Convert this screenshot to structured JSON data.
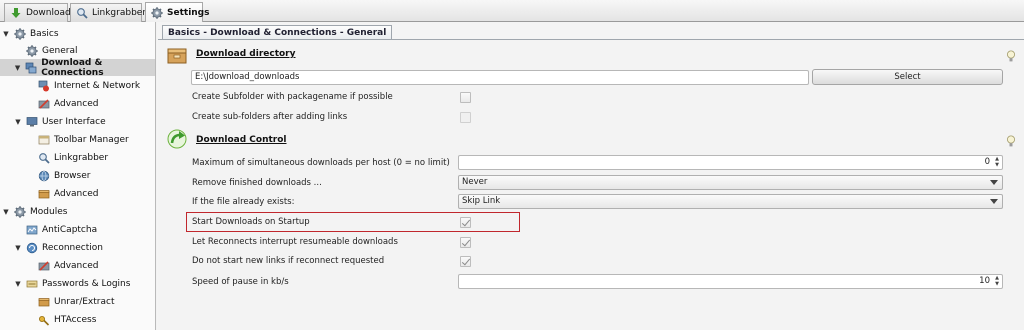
{
  "tabs": [
    {
      "label": "Download",
      "icon": "download-arrow-icon"
    },
    {
      "label": "Linkgrabber",
      "icon": "linkgrabber-icon"
    },
    {
      "label": "Settings",
      "icon": "gear-icon"
    }
  ],
  "sidebar": {
    "items": [
      {
        "label": "Basics",
        "icon": "gear-icon"
      },
      {
        "label": "General",
        "icon": "gear-icon"
      },
      {
        "label": "Download & Connections",
        "icon": "network-icon"
      },
      {
        "label": "Internet & Network",
        "icon": "network-warning-icon"
      },
      {
        "label": "Advanced",
        "icon": "advanced-tools-icon"
      },
      {
        "label": "User Interface",
        "icon": "monitor-icon"
      },
      {
        "label": "Toolbar Manager",
        "icon": "toolbar-icon"
      },
      {
        "label": "Linkgrabber",
        "icon": "linkgrabber-icon"
      },
      {
        "label": "Browser",
        "icon": "browser-icon"
      },
      {
        "label": "Advanced",
        "icon": "advanced-box-icon"
      },
      {
        "label": "Modules",
        "icon": "gear-icon"
      },
      {
        "label": "AntiCaptcha",
        "icon": "captcha-icon"
      },
      {
        "label": "Reconnection",
        "icon": "reconnect-icon"
      },
      {
        "label": "Advanced",
        "icon": "advanced-tools-icon"
      },
      {
        "label": "Passwords & Logins",
        "icon": "password-icon"
      },
      {
        "label": "Unrar/Extract",
        "icon": "archive-box-icon"
      },
      {
        "label": "HTAccess",
        "icon": "key-icon"
      }
    ]
  },
  "panel_tab": "Basics - Download & Connections - General",
  "download_directory": {
    "title": "Download directory",
    "path_value": "E:\\Jdownload_downloads",
    "select_label": "Select",
    "create_subfolder_label": "Create Subfolder with packagename if possible",
    "create_subfolder_checked": false,
    "create_subfolders_after_adding_label": "Create sub-folders after adding links",
    "create_subfolders_after_adding_checked": false
  },
  "download_control": {
    "title": "Download Control",
    "max_downloads_label": "Maximum of simultaneous downloads per host (0 = no limit)",
    "max_downloads_value": "0",
    "remove_finished_label": "Remove finished downloads ...",
    "remove_finished_value": "Never",
    "file_exists_label": "If the file already exists:",
    "file_exists_value": "Skip Link",
    "start_on_startup_label": "Start Downloads on Startup",
    "start_on_startup_checked": true,
    "reconnects_interrupt_label": "Let Reconnects interrupt resumeable downloads",
    "reconnects_interrupt_checked": true,
    "no_new_links_label": "Do not start new links if reconnect requested",
    "no_new_links_checked": true,
    "pause_speed_label": "Speed of pause in kb/s",
    "pause_speed_value": "10"
  },
  "colors": {
    "highlight": "#c0272d",
    "selected_row": "#d3d3d3"
  }
}
